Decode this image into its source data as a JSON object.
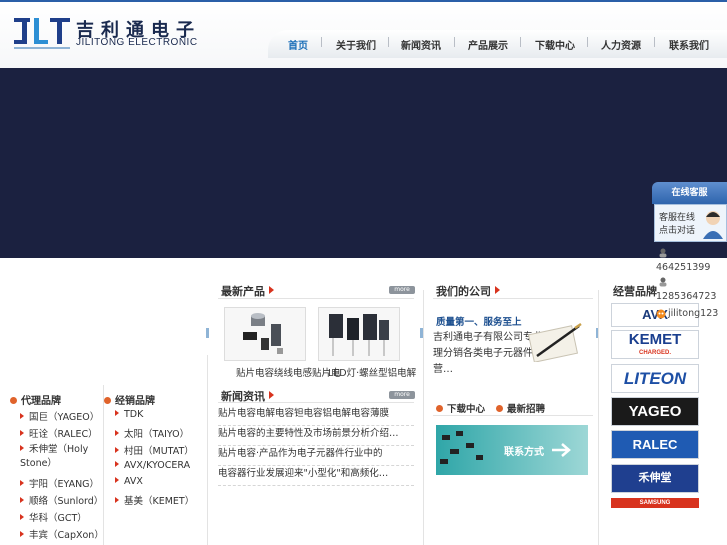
{
  "header": {
    "logo_cn": "吉利通电子",
    "logo_en": "JILITONG ELECTRONIC",
    "nav": [
      "首页",
      "关于我们",
      "新闻资讯",
      "产品展示",
      "下载中心",
      "人力资源",
      "联系我们"
    ]
  },
  "products": {
    "title": "最新产品",
    "more": "more",
    "items": [
      {
        "caption": "贴片电容绕线电感贴片电"
      },
      {
        "caption": "LED灯·螺丝型铝电解"
      }
    ]
  },
  "news": {
    "title": "新闻资讯",
    "more": "more",
    "items": [
      "贴片电容电解电容钽电容铝电解电容薄膜",
      "贴片电容的主要特性及市场前景分析介绍…",
      "贴片电容·产品作为电子元器件行业中的",
      "电容器行业发展迎来\"小型化\"和高频化…"
    ]
  },
  "agency": {
    "title": "代理品牌",
    "items": [
      "国巨（YAGEO）",
      "旺诠（RALEC）",
      "禾伸堂（Holy Stone）",
      "宇阳（EYANG）",
      "顺络（Sunlord）",
      "华科（GCT）",
      "丰宾（CapXon）"
    ]
  },
  "dist": {
    "title": "经销品牌",
    "items": [
      "TDK",
      "太阳（TAIYO）",
      "村田（MUTAT）",
      "AVX/KYOCERA",
      "AVX",
      "基美（KEMET）"
    ]
  },
  "company": {
    "title": "我们的公司",
    "slogan": "质量第一、服务至上",
    "text": "吉利通电子有限公司专业代理分销各类电子元器件，主营…"
  },
  "links": {
    "download": "下载中心",
    "jobs": "最新招聘",
    "contact": "联系方式"
  },
  "brands": {
    "title": "经营品牌",
    "items": [
      "AVX",
      "KEMET",
      "LITEON",
      "YAGEO",
      "RALEC",
      "禾伸堂",
      "SAMSUNG"
    ],
    "kemet_sub": "CHARGED."
  },
  "chat": {
    "title": "在线客服",
    "line1": "客服在线",
    "line2": "点击对话",
    "qq1": "464251399",
    "qq2": "1285364723",
    "skype": "jilitong123"
  },
  "colors": {
    "accent": "#1c6fb8",
    "banner": "#1b2140",
    "arrow": "#d8331e"
  }
}
